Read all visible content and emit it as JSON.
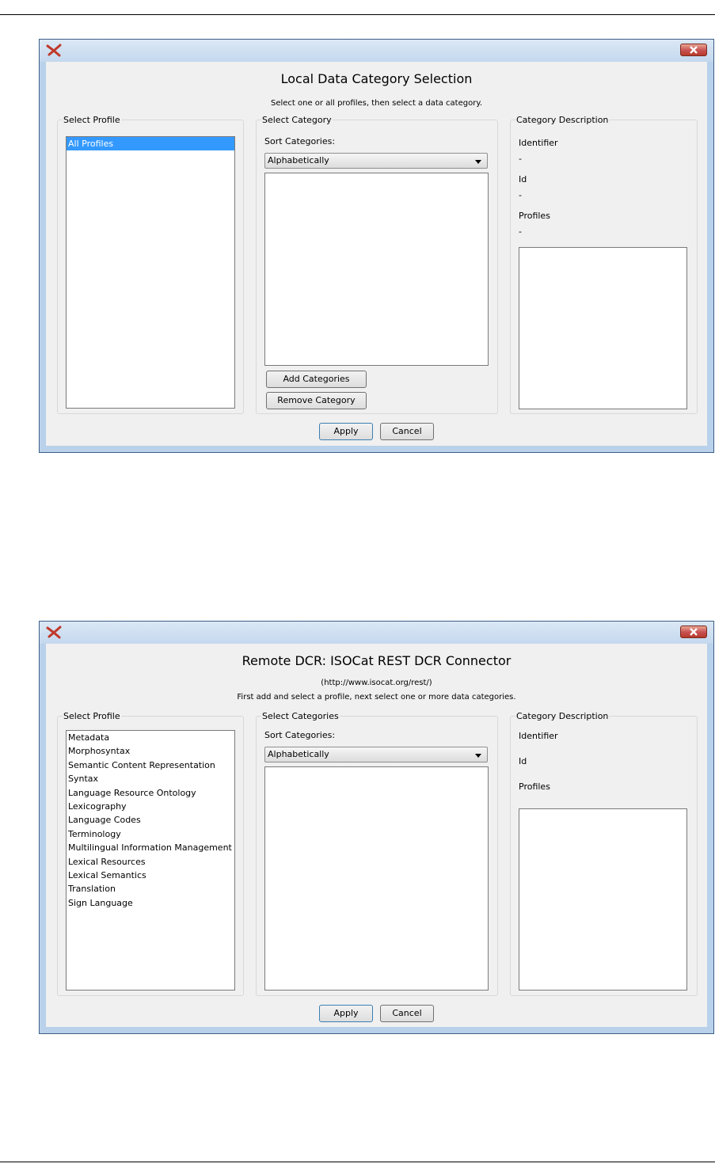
{
  "colors": {
    "title_bar": "#c4d8ee",
    "frame": "#b9d1ea",
    "selection": "#3399ff",
    "close_button": "#c75050"
  },
  "local": {
    "title": "Local Data Category Selection",
    "subtitle": "Select one or all profiles, then select a data category.",
    "profile_group": "Select Profile",
    "profiles": [
      "All Profiles"
    ],
    "selected_profile": "All Profiles",
    "category_group": "Select Category",
    "sort_label": "Sort Categories:",
    "sort_value": "Alphabetically",
    "add_button": "Add Categories",
    "remove_button": "Remove Category",
    "description_group": "Category Description",
    "identifier_label": "Identifier",
    "identifier_value": "-",
    "id_label": "Id",
    "id_value": "-",
    "profiles_label": "Profiles",
    "profiles_value": "-",
    "apply_button": "Apply",
    "cancel_button": "Cancel"
  },
  "remote": {
    "title": "Remote DCR: ISOCat REST DCR Connector",
    "url": "(http://www.isocat.org/rest/)",
    "subtitle": "First add and select a profile, next select one or more data categories.",
    "profile_group": "Select Profile",
    "profiles": [
      "Metadata",
      "Morphosyntax",
      "Semantic Content Representation",
      "Syntax",
      "Language Resource Ontology",
      "Lexicography",
      "Language Codes",
      "Terminology",
      "Multilingual Information Management",
      "Lexical Resources",
      "Lexical Semantics",
      "Translation",
      "Sign Language"
    ],
    "category_group": "Select Categories",
    "sort_label": "Sort Categories:",
    "sort_value": "Alphabetically",
    "description_group": "Category Description",
    "identifier_label": "Identifier",
    "id_label": "Id",
    "profiles_label": "Profiles",
    "apply_button": "Apply",
    "cancel_button": "Cancel"
  }
}
